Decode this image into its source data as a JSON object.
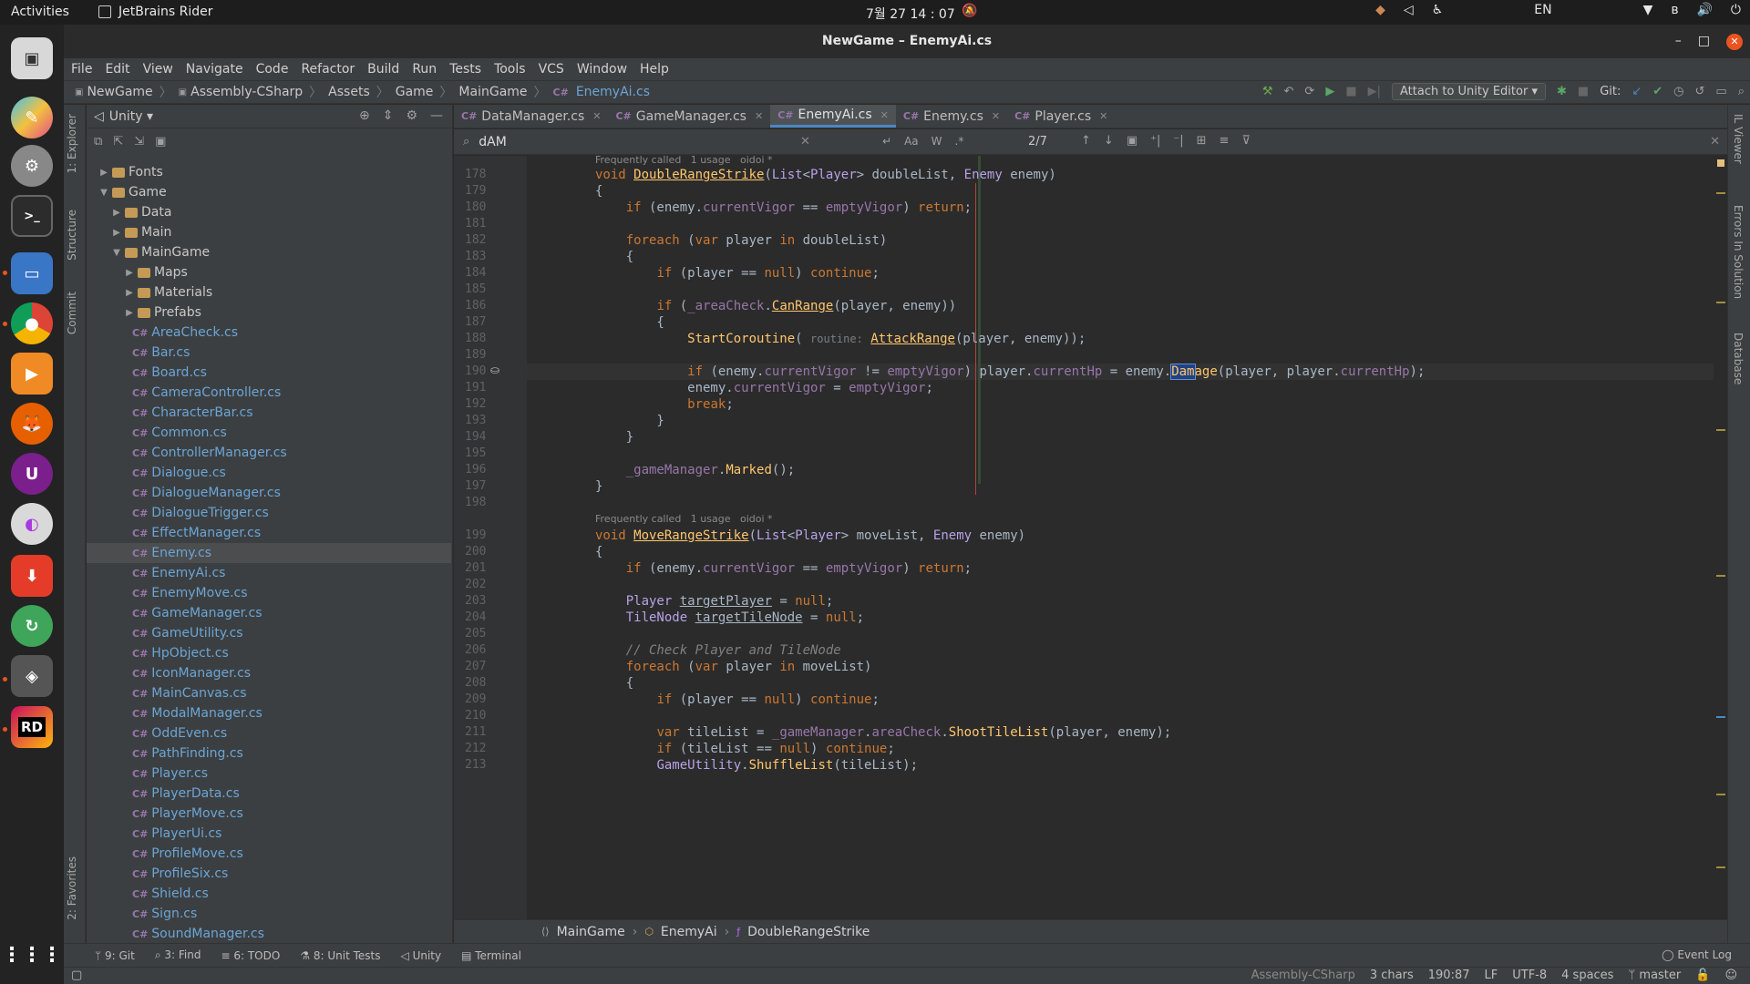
{
  "topbar": {
    "activities": "Activities",
    "app_name": "JetBrains Rider",
    "clock": "7월 27  14 : 07",
    "lang": "EN"
  },
  "window": {
    "title": "NewGame – EnemyAi.cs"
  },
  "menu": [
    "File",
    "Edit",
    "View",
    "Navigate",
    "Code",
    "Refactor",
    "Build",
    "Run",
    "Tests",
    "Tools",
    "VCS",
    "Window",
    "Help"
  ],
  "nav": {
    "crumbs": [
      "NewGame",
      "Assembly-CSharp",
      "Assets",
      "Game",
      "MainGame",
      "EnemyAi.cs"
    ],
    "attach_label": "Attach to Unity Editor",
    "git_label": "Git:"
  },
  "side_labels": {
    "explorer": "1: Explorer",
    "structure": "Structure",
    "commit": "Commit",
    "favorites": "2: Favorites",
    "il_viewer": "IL Viewer",
    "errors": "Errors In Solution",
    "database": "Database"
  },
  "project": {
    "title": "Unity",
    "tree": [
      {
        "name": "Fonts",
        "kind": "folder",
        "depth": 1,
        "arrow": "▶"
      },
      {
        "name": "Game",
        "kind": "folder",
        "depth": 1,
        "arrow": "▼"
      },
      {
        "name": "Data",
        "kind": "folder",
        "depth": 2,
        "arrow": "▶"
      },
      {
        "name": "Main",
        "kind": "folder",
        "depth": 2,
        "arrow": "▶"
      },
      {
        "name": "MainGame",
        "kind": "folder",
        "depth": 2,
        "arrow": "▼"
      },
      {
        "name": "Maps",
        "kind": "folder",
        "depth": 3,
        "arrow": "▶"
      },
      {
        "name": "Materials",
        "kind": "folder",
        "depth": 3,
        "arrow": "▶"
      },
      {
        "name": "Prefabs",
        "kind": "folder",
        "depth": 3,
        "arrow": "▶"
      },
      {
        "name": "AreaCheck.cs",
        "kind": "cs",
        "depth": 3
      },
      {
        "name": "Bar.cs",
        "kind": "cs",
        "depth": 3
      },
      {
        "name": "Board.cs",
        "kind": "cs",
        "depth": 3
      },
      {
        "name": "CameraController.cs",
        "kind": "cs",
        "depth": 3
      },
      {
        "name": "CharacterBar.cs",
        "kind": "cs",
        "depth": 3
      },
      {
        "name": "Common.cs",
        "kind": "cs",
        "depth": 3
      },
      {
        "name": "ControllerManager.cs",
        "kind": "cs",
        "depth": 3
      },
      {
        "name": "Dialogue.cs",
        "kind": "cs",
        "depth": 3
      },
      {
        "name": "DialogueManager.cs",
        "kind": "cs",
        "depth": 3
      },
      {
        "name": "DialogueTrigger.cs",
        "kind": "cs",
        "depth": 3
      },
      {
        "name": "EffectManager.cs",
        "kind": "cs",
        "depth": 3
      },
      {
        "name": "Enemy.cs",
        "kind": "cs",
        "depth": 3,
        "selected": true
      },
      {
        "name": "EnemyAi.cs",
        "kind": "cs",
        "depth": 3
      },
      {
        "name": "EnemyMove.cs",
        "kind": "cs",
        "depth": 3
      },
      {
        "name": "GameManager.cs",
        "kind": "cs",
        "depth": 3
      },
      {
        "name": "GameUtility.cs",
        "kind": "cs",
        "depth": 3
      },
      {
        "name": "HpObject.cs",
        "kind": "cs",
        "depth": 3
      },
      {
        "name": "IconManager.cs",
        "kind": "cs",
        "depth": 3
      },
      {
        "name": "MainCanvas.cs",
        "kind": "cs",
        "depth": 3
      },
      {
        "name": "ModalManager.cs",
        "kind": "cs",
        "depth": 3
      },
      {
        "name": "OddEven.cs",
        "kind": "cs",
        "depth": 3
      },
      {
        "name": "PathFinding.cs",
        "kind": "cs",
        "depth": 3
      },
      {
        "name": "Player.cs",
        "kind": "cs",
        "depth": 3
      },
      {
        "name": "PlayerData.cs",
        "kind": "cs",
        "depth": 3
      },
      {
        "name": "PlayerMove.cs",
        "kind": "cs",
        "depth": 3
      },
      {
        "name": "PlayerUi.cs",
        "kind": "cs",
        "depth": 3
      },
      {
        "name": "ProfileMove.cs",
        "kind": "cs",
        "depth": 3
      },
      {
        "name": "ProfileSix.cs",
        "kind": "cs",
        "depth": 3
      },
      {
        "name": "Shield.cs",
        "kind": "cs",
        "depth": 3
      },
      {
        "name": "Sign.cs",
        "kind": "cs",
        "depth": 3
      },
      {
        "name": "SoundManager.cs",
        "kind": "cs",
        "depth": 3
      }
    ]
  },
  "tabs": [
    {
      "label": "DataManager.cs",
      "active": false
    },
    {
      "label": "GameManager.cs",
      "active": false
    },
    {
      "label": "EnemyAi.cs",
      "active": true
    },
    {
      "label": "Enemy.cs",
      "active": false
    },
    {
      "label": "Player.cs",
      "active": false
    }
  ],
  "find": {
    "query": "dAM",
    "count": "2/7",
    "opt_case": "Aa",
    "opt_word": "W",
    "opt_regex": ".*"
  },
  "code": {
    "hint_a": "Frequently called   1 usage   oidoi *",
    "hint_b": "Frequently called   1 usage   oidoi *",
    "lines": [
      {
        "n": "178",
        "html": "<span class='kw'>void</span> <span class='fnd'>DoubleRangeStrike</span>(<span class='ty'>List</span>&lt;<span class='ty'>Player</span>&gt; doubleList, <span class='ty'>Enemy</span> enemy)"
      },
      {
        "n": "179",
        "html": "{"
      },
      {
        "n": "180",
        "html": "    <span class='kw'>if</span> (enemy.<span class='fd'>currentVigor</span> == <span class='fd'>emptyVigor</span>) <span class='kw'>return</span>;"
      },
      {
        "n": "181",
        "html": ""
      },
      {
        "n": "182",
        "html": "    <span class='kw'>foreach</span> (<span class='kw'>var</span> player <span class='kw'>in</span> doubleList)"
      },
      {
        "n": "183",
        "html": "    {"
      },
      {
        "n": "184",
        "html": "        <span class='kw'>if</span> (player == <span class='kw'>null</span>) <span class='kw'>continue</span>;"
      },
      {
        "n": "185",
        "html": ""
      },
      {
        "n": "186",
        "html": "        <span class='kw'>if</span> (<span class='fd'>_areaCheck</span>.<span class='fnd'>CanRange</span>(player, enemy))"
      },
      {
        "n": "187",
        "html": "        {"
      },
      {
        "n": "188",
        "html": "            <span class='mt'>StartCoroutine</span>( <span class='pm'>routine:</span> <span class='fnd'>AttackRange</span>(player, enemy));"
      },
      {
        "n": "189",
        "html": ""
      },
      {
        "n": "190",
        "html": "            <span class='kw'>if</span> (enemy.<span class='fd'>currentVigor</span> != <span class='fd'>emptyVigor</span>) player.<span class='fd'>currentHp</span> = enemy.<span class='hl mt'>Dam</span><span class='mt'>age</span>(player, player.<span class='fd'>currentHp</span>);"
      },
      {
        "n": "191",
        "html": "            enemy.<span class='fd'>currentVigor</span> = <span class='fd'>emptyVigor</span>;"
      },
      {
        "n": "192",
        "html": "            <span class='kw'>break</span>;"
      },
      {
        "n": "193",
        "html": "        }"
      },
      {
        "n": "194",
        "html": "    }"
      },
      {
        "n": "195",
        "html": ""
      },
      {
        "n": "196",
        "html": "    <span class='fd'>_gameManager</span>.<span class='mt'>Marked</span>();"
      },
      {
        "n": "197",
        "html": "}"
      },
      {
        "n": "198",
        "html": ""
      },
      {
        "n": "199",
        "html": "<span class='kw'>void</span> <span class='fnd'>MoveRangeStrike</span>(<span class='ty'>List</span>&lt;<span class='ty'>Player</span>&gt; moveList, <span class='ty'>Enemy</span> enemy)"
      },
      {
        "n": "200",
        "html": "{"
      },
      {
        "n": "201",
        "html": "    <span class='kw'>if</span> (enemy.<span class='fd'>currentVigor</span> == <span class='fd'>emptyVigor</span>) <span class='kw'>return</span>;"
      },
      {
        "n": "202",
        "html": ""
      },
      {
        "n": "203",
        "html": "    <span class='ty'>Player</span> <u>targetPlayer</u> = <span class='kw'>null</span>;"
      },
      {
        "n": "204",
        "html": "    <span class='ty'>TileNode</span> <u>targetTileNode</u> = <span class='kw'>null</span>;"
      },
      {
        "n": "205",
        "html": ""
      },
      {
        "n": "206",
        "html": "    <span class='cm'>// Check Player and TileNode</span>"
      },
      {
        "n": "207",
        "html": "    <span class='kw'>foreach</span> (<span class='kw'>var</span> player <span class='kw'>in</span> moveList)"
      },
      {
        "n": "208",
        "html": "    {"
      },
      {
        "n": "209",
        "html": "        <span class='kw'>if</span> (player == <span class='kw'>null</span>) <span class='kw'>continue</span>;"
      },
      {
        "n": "210",
        "html": ""
      },
      {
        "n": "211",
        "html": "        <span class='kw'>var</span> tileList = <span class='fd'>_gameManager</span>.<span class='fd'>areaCheck</span>.<span class='mt'>ShootTileList</span>(player, enemy);"
      },
      {
        "n": "212",
        "html": "        <span class='kw'>if</span> (tileList == <span class='kw'>null</span>) <span class='kw'>continue</span>;"
      },
      {
        "n": "213",
        "html": "        <span class='ty'>GameUtility</span>.<span class='mt'>ShuffleList</span>(tileList);"
      }
    ]
  },
  "code_crumb": [
    "MainGame",
    "EnemyAi",
    "DoubleRangeStrike"
  ],
  "bottom_tools": [
    "9: Git",
    "3: Find",
    "6: TODO",
    "8: Unit Tests",
    "Unity",
    "Terminal"
  ],
  "event_log": "Event Log",
  "status": {
    "project": "Assembly-CSharp",
    "selection": "3 chars",
    "position": "190:87",
    "line_sep": "LF",
    "encoding": "UTF-8",
    "indent": "4 spaces",
    "branch": "master"
  },
  "colors": {
    "accent": "#4a88c7",
    "ubuntu_orange": "#e95420"
  }
}
